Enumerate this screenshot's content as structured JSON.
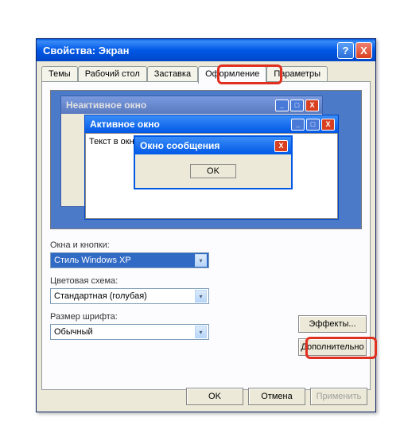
{
  "titlebar": {
    "title": "Свойства: Экран",
    "help": "?",
    "close": "X"
  },
  "tabs": {
    "themes": "Темы",
    "desktop": "Рабочий стол",
    "screensaver": "Заставка",
    "appearance": "Оформление",
    "settings": "Параметры"
  },
  "preview": {
    "inactive_title": "Неактивное окно",
    "active_title": "Активное окно",
    "window_text": "Текст в окне",
    "msgbox_title": "Окно сообщения",
    "msgbox_ok": "OK"
  },
  "fields": {
    "windows_buttons_label": "Окна и кнопки:",
    "windows_buttons_value": "Стиль Windows XP",
    "color_scheme_label": "Цветовая схема:",
    "color_scheme_value": "Стандартная (голубая)",
    "font_size_label": "Размер шрифта:",
    "font_size_value": "Обычный"
  },
  "buttons": {
    "effects": "Эффекты...",
    "advanced": "Дополнительно",
    "ok": "OK",
    "cancel": "Отмена",
    "apply": "Применить"
  },
  "glyphs": {
    "dropdown": "▾",
    "min": "_",
    "max": "□",
    "close": "X"
  }
}
